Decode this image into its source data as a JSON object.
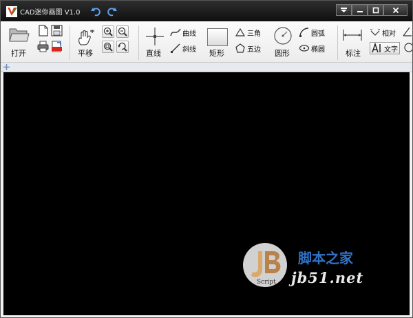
{
  "window": {
    "title": "CAD迷你画图 V1.0"
  },
  "ribbon": {
    "open_label": "打开",
    "pan_label": "平移",
    "line_label": "直线",
    "curve_label": "曲线",
    "slant_label": "斜线",
    "rect_label": "矩形",
    "triangle_label": "三角",
    "pentagon_label": "五边",
    "circle_label": "圆形",
    "arc_label": "圆弧",
    "ellipse_label": "椭圆",
    "dimension_label": "标注",
    "relative_label": "相对",
    "text_label": "文字"
  },
  "watermark": {
    "logo_text": "Script",
    "site_name": "脚本之家",
    "url": "jb51.net"
  },
  "colors": {
    "titlebar": "#1a1a1a",
    "canvas": "#000000",
    "ribbon": "#f2f2f2",
    "accent": "#2f73c9"
  }
}
